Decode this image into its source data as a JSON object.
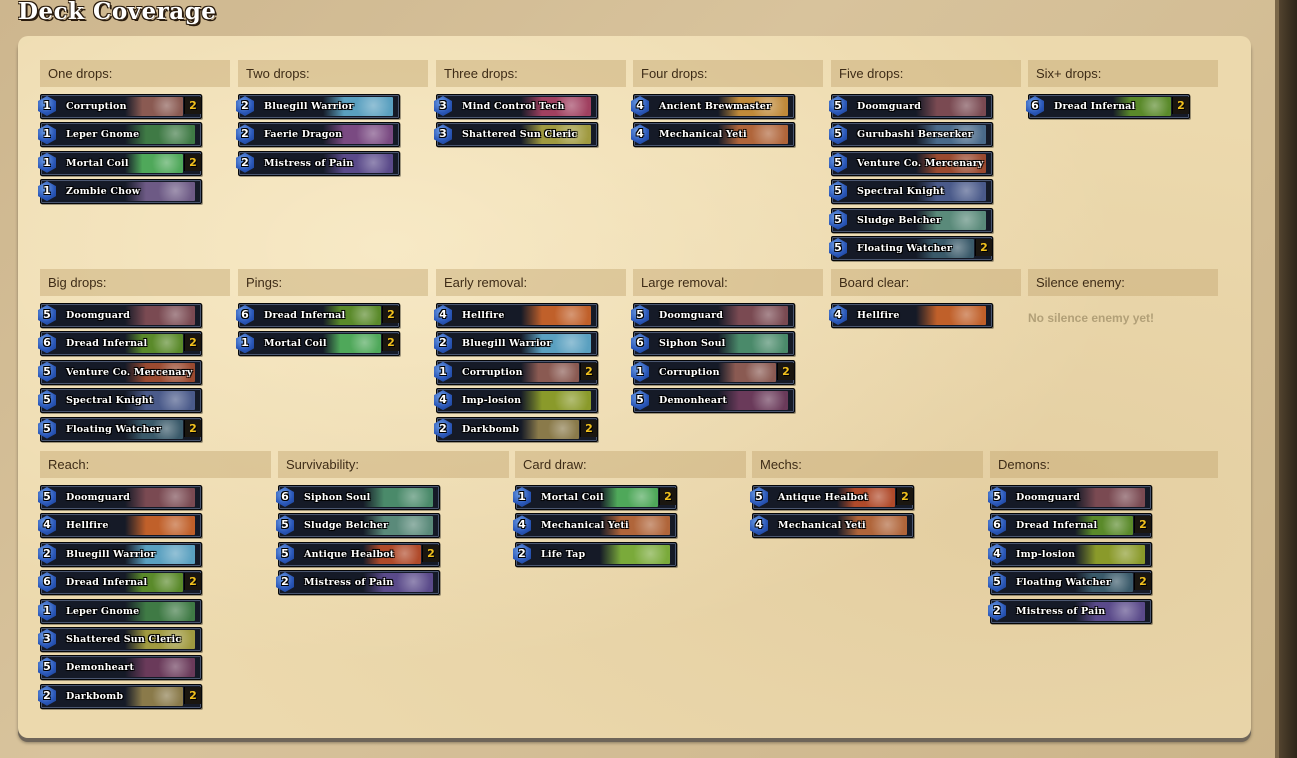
{
  "page": {
    "title": "Deck Coverage"
  },
  "art": {
    "Corruption": "#8a5a52",
    "Leper Gnome": "#3f7a45",
    "Mortal Coil": "#4fa85a",
    "Zombie Chow": "#6d5a85",
    "Bluegill Warrior": "#5aa0c0",
    "Faerie Dragon": "#7a4a82",
    "Mistress of Pain": "#5a4a8a",
    "Mind Control Tech": "#a04060",
    "Shattered Sun Cleric": "#a09a40",
    "Ancient Brewmaster": "#c08a3a",
    "Mechanical Yeti": "#b0653a",
    "Doomguard": "#7a4a52",
    "Gurubashi Berserker": "#4a6a8a",
    "Venture Co. Mercenary": "#9a4a30",
    "Spectral Knight": "#4a5a8a",
    "Sludge Belcher": "#5a8a7a",
    "Floating Watcher": "#3a5a6a",
    "Dread Infernal": "#5a8a2a",
    "Hellfire": "#c0602a",
    "Imp-losion": "#8a9a2a",
    "Darkbomb": "#8a7a4a",
    "Siphon Soul": "#4a8a6a",
    "Demonheart": "#6a3a5a",
    "Antique Healbot": "#b04a2a",
    "Life Tap": "#7aaa3a"
  },
  "sections": [
    {
      "name": "One drops:",
      "cards": [
        {
          "cost": "1",
          "name": "Corruption",
          "count": "2"
        },
        {
          "cost": "1",
          "name": "Leper Gnome",
          "count": ""
        },
        {
          "cost": "1",
          "name": "Mortal Coil",
          "count": "2"
        },
        {
          "cost": "1",
          "name": "Zombie Chow",
          "count": ""
        }
      ]
    },
    {
      "name": "Two drops:",
      "cards": [
        {
          "cost": "2",
          "name": "Bluegill Warrior",
          "count": ""
        },
        {
          "cost": "2",
          "name": "Faerie Dragon",
          "count": ""
        },
        {
          "cost": "2",
          "name": "Mistress of Pain",
          "count": ""
        }
      ]
    },
    {
      "name": "Three drops:",
      "cards": [
        {
          "cost": "3",
          "name": "Mind Control Tech",
          "count": ""
        },
        {
          "cost": "3",
          "name": "Shattered Sun Cleric",
          "count": ""
        }
      ]
    },
    {
      "name": "Four drops:",
      "cards": [
        {
          "cost": "4",
          "name": "Ancient Brewmaster",
          "count": ""
        },
        {
          "cost": "4",
          "name": "Mechanical Yeti",
          "count": ""
        }
      ]
    },
    {
      "name": "Five drops:",
      "cards": [
        {
          "cost": "5",
          "name": "Doomguard",
          "count": ""
        },
        {
          "cost": "5",
          "name": "Gurubashi Berserker",
          "count": ""
        },
        {
          "cost": "5",
          "name": "Venture Co. Mercenary",
          "count": ""
        },
        {
          "cost": "5",
          "name": "Spectral Knight",
          "count": ""
        },
        {
          "cost": "5",
          "name": "Sludge Belcher",
          "count": ""
        },
        {
          "cost": "5",
          "name": "Floating Watcher",
          "count": "2"
        }
      ]
    },
    {
      "name": "Six+ drops:",
      "cards": [
        {
          "cost": "6",
          "name": "Dread Infernal",
          "count": "2"
        }
      ]
    },
    {
      "name": "Big drops:",
      "cards": [
        {
          "cost": "5",
          "name": "Doomguard",
          "count": ""
        },
        {
          "cost": "6",
          "name": "Dread Infernal",
          "count": "2"
        },
        {
          "cost": "5",
          "name": "Venture Co. Mercenary",
          "count": ""
        },
        {
          "cost": "5",
          "name": "Spectral Knight",
          "count": ""
        },
        {
          "cost": "5",
          "name": "Floating Watcher",
          "count": "2"
        }
      ]
    },
    {
      "name": "Pings:",
      "cards": [
        {
          "cost": "6",
          "name": "Dread Infernal",
          "count": "2"
        },
        {
          "cost": "1",
          "name": "Mortal Coil",
          "count": "2"
        }
      ]
    },
    {
      "name": "Early removal:",
      "cards": [
        {
          "cost": "4",
          "name": "Hellfire",
          "count": ""
        },
        {
          "cost": "2",
          "name": "Bluegill Warrior",
          "count": ""
        },
        {
          "cost": "1",
          "name": "Corruption",
          "count": "2"
        },
        {
          "cost": "4",
          "name": "Imp-losion",
          "count": ""
        },
        {
          "cost": "2",
          "name": "Darkbomb",
          "count": "2"
        }
      ]
    },
    {
      "name": "Large removal:",
      "cards": [
        {
          "cost": "5",
          "name": "Doomguard",
          "count": ""
        },
        {
          "cost": "6",
          "name": "Siphon Soul",
          "count": ""
        },
        {
          "cost": "1",
          "name": "Corruption",
          "count": "2"
        },
        {
          "cost": "5",
          "name": "Demonheart",
          "count": ""
        }
      ]
    },
    {
      "name": "Board clear:",
      "cards": [
        {
          "cost": "4",
          "name": "Hellfire",
          "count": ""
        }
      ]
    },
    {
      "name": "Silence enemy:",
      "cards": [],
      "empty": "No silence enemy yet!"
    },
    {
      "name": "Reach:",
      "cards": [
        {
          "cost": "5",
          "name": "Doomguard",
          "count": ""
        },
        {
          "cost": "4",
          "name": "Hellfire",
          "count": ""
        },
        {
          "cost": "2",
          "name": "Bluegill Warrior",
          "count": ""
        },
        {
          "cost": "6",
          "name": "Dread Infernal",
          "count": "2"
        },
        {
          "cost": "1",
          "name": "Leper Gnome",
          "count": ""
        },
        {
          "cost": "3",
          "name": "Shattered Sun Cleric",
          "count": ""
        },
        {
          "cost": "5",
          "name": "Demonheart",
          "count": ""
        },
        {
          "cost": "2",
          "name": "Darkbomb",
          "count": "2"
        }
      ]
    },
    {
      "name": "Survivability:",
      "cards": [
        {
          "cost": "6",
          "name": "Siphon Soul",
          "count": ""
        },
        {
          "cost": "5",
          "name": "Sludge Belcher",
          "count": ""
        },
        {
          "cost": "5",
          "name": "Antique Healbot",
          "count": "2"
        },
        {
          "cost": "2",
          "name": "Mistress of Pain",
          "count": ""
        }
      ]
    },
    {
      "name": "Card draw:",
      "cards": [
        {
          "cost": "1",
          "name": "Mortal Coil",
          "count": "2"
        },
        {
          "cost": "4",
          "name": "Mechanical Yeti",
          "count": ""
        },
        {
          "cost": "2",
          "name": "Life Tap",
          "count": ""
        }
      ]
    },
    {
      "name": "Mechs:",
      "cards": [
        {
          "cost": "5",
          "name": "Antique Healbot",
          "count": "2"
        },
        {
          "cost": "4",
          "name": "Mechanical Yeti",
          "count": ""
        }
      ]
    },
    {
      "name": "Demons:",
      "cards": [
        {
          "cost": "5",
          "name": "Doomguard",
          "count": ""
        },
        {
          "cost": "6",
          "name": "Dread Infernal",
          "count": "2"
        },
        {
          "cost": "4",
          "name": "Imp-losion",
          "count": ""
        },
        {
          "cost": "5",
          "name": "Floating Watcher",
          "count": "2"
        },
        {
          "cost": "2",
          "name": "Mistress of Pain",
          "count": ""
        }
      ]
    }
  ]
}
